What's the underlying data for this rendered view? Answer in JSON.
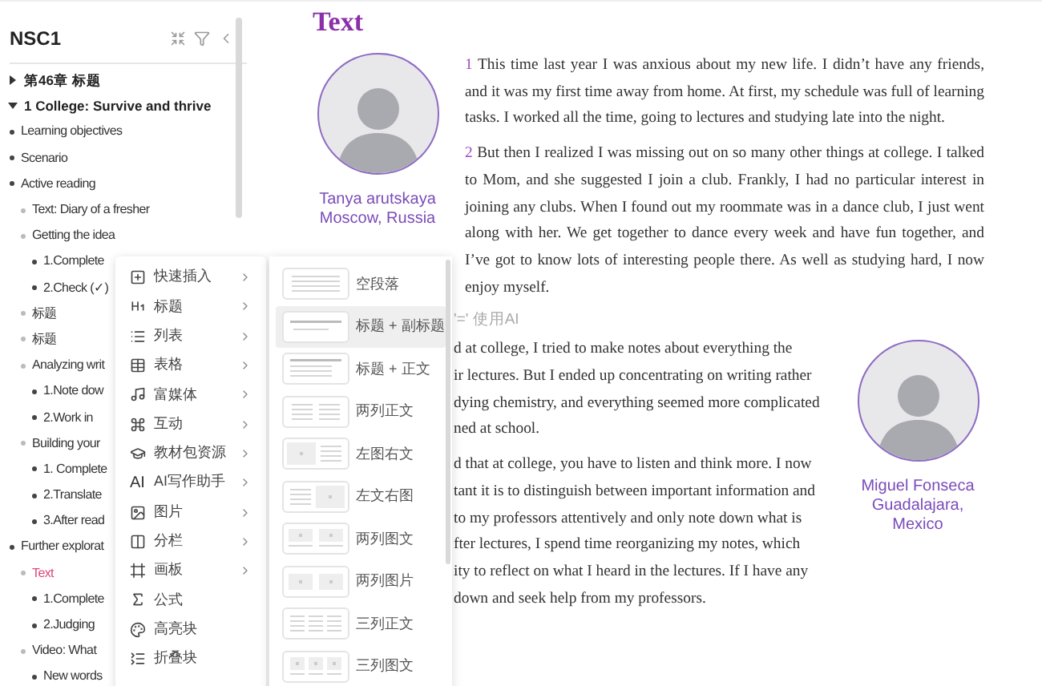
{
  "sidebar": {
    "title": "NSC1",
    "tree": [
      {
        "label": "第46章 标题",
        "kind": "chapter",
        "expanded": false,
        "selected": false
      },
      {
        "label": "1 College: Survive and thrive",
        "kind": "chapter",
        "expanded": true,
        "selected": false,
        "children": [
          {
            "label": "Learning objectives",
            "kind": "entry",
            "selected": false
          },
          {
            "label": "Scenario",
            "kind": "entry",
            "selected": false
          },
          {
            "label": "Active reading",
            "kind": "entry",
            "selected": false,
            "children": [
              {
                "label": "Text: Diary of a fresher",
                "kind": "entry",
                "selected": false
              },
              {
                "label": "Getting the idea",
                "kind": "entry",
                "selected": false,
                "children": [
                  {
                    "label": "1.Complete",
                    "kind": "entry",
                    "selected": false
                  },
                  {
                    "label": "2.Check (✓)",
                    "kind": "entry",
                    "selected": false
                  }
                ]
              },
              {
                "label": "标题",
                "kind": "entry",
                "selected": false
              },
              {
                "label": "标题",
                "kind": "entry",
                "selected": false
              },
              {
                "label": "Analyzing writ",
                "kind": "entry",
                "selected": false,
                "children": [
                  {
                    "label": "1.Note dow",
                    "kind": "entry",
                    "selected": false
                  },
                  {
                    "label": "2.Work in",
                    "kind": "entry",
                    "selected": false
                  }
                ]
              },
              {
                "label": "Building your",
                "kind": "entry",
                "selected": false,
                "children": [
                  {
                    "label": "1. Complete",
                    "kind": "entry",
                    "selected": false
                  },
                  {
                    "label": "2.Translate",
                    "kind": "entry",
                    "selected": false
                  },
                  {
                    "label": "3.After read",
                    "kind": "entry",
                    "selected": false
                  }
                ]
              }
            ]
          },
          {
            "label": "Further explorat",
            "kind": "entry",
            "selected": false,
            "children": [
              {
                "label": "Text",
                "kind": "entry",
                "selected": true,
                "children": [
                  {
                    "label": "1.Complete",
                    "kind": "entry",
                    "selected": false
                  },
                  {
                    "label": "2.Judging",
                    "kind": "entry",
                    "selected": false
                  }
                ]
              },
              {
                "label": "Video: What",
                "kind": "entry",
                "selected": false,
                "children": [
                  {
                    "label": "New words",
                    "kind": "entry",
                    "selected": false
                  }
                ]
              }
            ]
          }
        ]
      }
    ]
  },
  "document": {
    "title": "Text",
    "person_1": {
      "name": "Tanya arutskaya",
      "place": "Moscow, Russia"
    },
    "paragraphs": [
      {
        "number": "1",
        "text": "This time last year I was anxious about my new life. I didn’t have any friends, and it was my first time away from home. At first, my schedule was full of learning tasks. I worked all the time, going to lectures and studying late into the night."
      },
      {
        "number": "2",
        "text": "But then I realized I was missing out on so many other things at college. I talked to Mom, and she suggested I join a club. Frankly, I had no particular interest in joining any clubs. When I found out my roommate was in a dance club, I just went along with her. We get together to dance every week and have fun together, and I’ve got to know lots of interesting people there. As well as studying hard, I now enjoy myself."
      }
    ],
    "ai_prompt": {
      "placeholder": "'=' 使用AI"
    },
    "partial_paragraphs": [
      [
        "d at college, I tried to make notes about everything the",
        "ir lectures. But I ended up concentrating on writing rather",
        "dying chemistry, and everything seemed more complicated",
        "ned at school."
      ],
      [
        "d that at college, you have to listen and think more. I now",
        "tant it is to distinguish between important information and",
        "to my professors attentively and only note down what is",
        "fter lectures, I spend time reorganizing my notes, which",
        "ity to reflect on what I heard in the lectures. If I have any",
        "down and seek help from my professors."
      ]
    ],
    "person_2": {
      "name": "Miguel Fonseca",
      "place": "Guadalajara, Mexico"
    }
  },
  "insert_menu": [
    {
      "label": "快速插入",
      "has_submenu": true
    },
    {
      "label": "标题",
      "has_submenu": true
    },
    {
      "label": "列表",
      "has_submenu": true
    },
    {
      "label": "表格",
      "has_submenu": true
    },
    {
      "label": "富媒体",
      "has_submenu": true
    },
    {
      "label": "互动",
      "has_submenu": true
    },
    {
      "label": "教材包资源",
      "has_submenu": true
    },
    {
      "label": "AI写作助手",
      "glyph": "AI",
      "has_submenu": true
    },
    {
      "label": "图片",
      "has_submenu": true
    },
    {
      "label": "分栏",
      "has_submenu": true
    },
    {
      "label": "画板",
      "has_submenu": true
    },
    {
      "label": "公式",
      "has_submenu": false
    },
    {
      "label": "高亮块",
      "has_submenu": false
    },
    {
      "label": "折叠块",
      "has_submenu": false
    }
  ],
  "layout_menu": [
    {
      "label": "空段落",
      "kind": "blank",
      "selected": false
    },
    {
      "label": "标题 + 副标题",
      "kind": "title_sub",
      "selected": true
    },
    {
      "label": "标题 + 正文",
      "kind": "title_body",
      "selected": false
    },
    {
      "label": "两列正文",
      "kind": "two_text",
      "selected": false
    },
    {
      "label": "左图右文",
      "kind": "img_left",
      "selected": false
    },
    {
      "label": "左文右图",
      "kind": "img_right",
      "selected": false
    },
    {
      "label": "两列图文",
      "kind": "two_imgtext",
      "selected": false
    },
    {
      "label": "两列图片",
      "kind": "two_img",
      "selected": false
    },
    {
      "label": "三列正文",
      "kind": "three_text",
      "selected": false
    },
    {
      "label": "三列图文",
      "kind": "three_imgtext",
      "selected": false
    }
  ]
}
